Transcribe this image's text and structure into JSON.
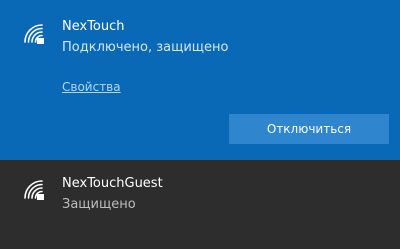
{
  "networks": [
    {
      "ssid": "NexTouch",
      "status": "Подключено, защищено",
      "properties_link": "Свойства",
      "disconnect_label": "Отключиться",
      "icon": "wifi-secured-icon"
    },
    {
      "ssid": "NexTouchGuest",
      "status": "Защищено",
      "icon": "wifi-secured-icon"
    }
  ],
  "colors": {
    "connected_bg": "#0a69b7",
    "other_bg": "#2d2d2d",
    "button_bg": "#2f86cf"
  }
}
